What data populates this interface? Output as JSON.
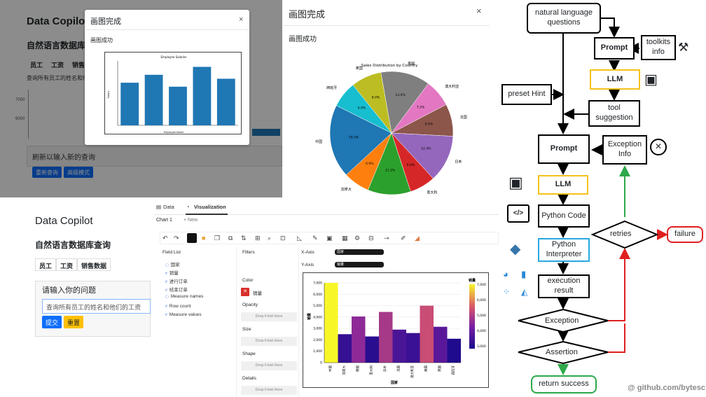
{
  "panel_a": {
    "app_title": "Data Copilot",
    "subtitle": "自然语言数据库查询",
    "tabs": [
      "员工",
      "工资",
      "销售数"
    ],
    "hint": "查询所有员工的姓名和他",
    "y_ticks": [
      "7000",
      "6000"
    ],
    "refresh_label": "刷新以输入新的查询",
    "requery_button": "重新查询",
    "advanced_button": "高级模式",
    "modal_title": "画图完成",
    "modal_close": "×",
    "modal_body": "画图成功",
    "plot_title": "Employee Salaries",
    "plot_xlabel": "Employee Name",
    "plot_ylabel": "Salary"
  },
  "chart_data": [
    {
      "type": "bar",
      "title": "Employee Salaries",
      "xlabel": "Employee Name",
      "ylabel": "Salary",
      "values": [
        4300,
        5100,
        3900,
        5900,
        4700
      ],
      "ylim": [
        0,
        6500
      ],
      "color": "#1f77b4"
    },
    {
      "type": "pie",
      "title": "Sales Distribution by Country",
      "slices": [
        {
          "label": "美国",
          "value": 13.0,
          "color": "#7f7f7f"
        },
        {
          "label": "澳大利亚",
          "value": 7.2,
          "color": "#e377c2"
        },
        {
          "label": "法国",
          "value": 8.5,
          "color": "#8c564b"
        },
        {
          "label": "日本",
          "value": 12.4,
          "color": "#9467bd"
        },
        {
          "label": "意大利",
          "value": 6.8,
          "color": "#d62728"
        },
        {
          "label": "德国",
          "value": 11.3,
          "color": "#2ca02c"
        },
        {
          "label": "加拿大",
          "value": 6.9,
          "color": "#ff7f0e"
        },
        {
          "label": "中国",
          "value": 19.3,
          "color": "#1f77b4"
        },
        {
          "label": "西班牙",
          "value": 6.9,
          "color": "#17becf"
        },
        {
          "label": "英国",
          "value": 8.0,
          "color": "#bcbd22"
        }
      ]
    },
    {
      "type": "bar",
      "xlabel": "国家",
      "ylabel": "销量",
      "legend_title": "销量",
      "categories": [
        "中国",
        "加拿大",
        "德国",
        "意大利",
        "日本",
        "法国",
        "澳大利亚",
        "美国",
        "英国",
        "西班牙"
      ],
      "values": [
        7000,
        2500,
        4050,
        2300,
        4450,
        2900,
        2600,
        5000,
        3150,
        2100
      ],
      "y_ticks": [
        "0",
        "1,000",
        "2,000",
        "3,000",
        "4,000",
        "5,000",
        "6,000",
        "7,000"
      ],
      "legend_ticks": [
        "7,000",
        "6,000",
        "5,000",
        "4,000",
        "3,000"
      ],
      "ylim": [
        0,
        7000
      ]
    }
  ],
  "panel_b": {
    "title": "画图完成",
    "close": "×",
    "body": "画图成功",
    "pie_title": "Sales Distribution by Country"
  },
  "panel_c": {
    "app_title": "Data Copilot",
    "subtitle": "自然语言数据库查询",
    "tabs": [
      "员工",
      "工资",
      "销售数据"
    ],
    "question_label": "请输入你的问题",
    "input_value": "查询所有员工的姓名和他们的工资",
    "submit_button": "提交",
    "reset_button": "重置",
    "submit_color": "#0d6efd",
    "reset_color": "#ffc107"
  },
  "panel_d": {
    "tab_data": "Data",
    "tab_visualization": "Visualization",
    "chart_tab": "Chart 1",
    "new_tab": "+ New",
    "field_list": "Field List",
    "fields": [
      "国家",
      "销量",
      "进行订单",
      "结束订单",
      "Measure names",
      "Row count",
      "Measure values"
    ],
    "filters": "Filters",
    "color": "Color",
    "color_field": "销量",
    "opacity": "Opacity",
    "size": "Size",
    "shape": "Shape",
    "details": "Details",
    "drop_field": "Drop Field Here",
    "x_axis": "X-Axis",
    "y_axis": "Y-Axis",
    "x_field": "国家",
    "y_field": "销量"
  },
  "flowchart": {
    "nodes": {
      "nlq": "natural language questions",
      "prompt1": "Prompt",
      "toolkits": "toolkits info",
      "llm1": "LLM",
      "preset": "preset  Hint",
      "tool_suggestion": "tool suggestion",
      "prompt2": "Prompt",
      "exception_info": "Exception Info",
      "llm2": "LLM",
      "python_code": "Python Code",
      "python_interpreter": "Python Interpreter",
      "execution_result": "execution result",
      "retries": "retries",
      "failure": "failure",
      "exception": "Exception",
      "assertion": "Assertion",
      "return_success": "return success"
    },
    "watermark": "@ github.com/bytesc"
  }
}
